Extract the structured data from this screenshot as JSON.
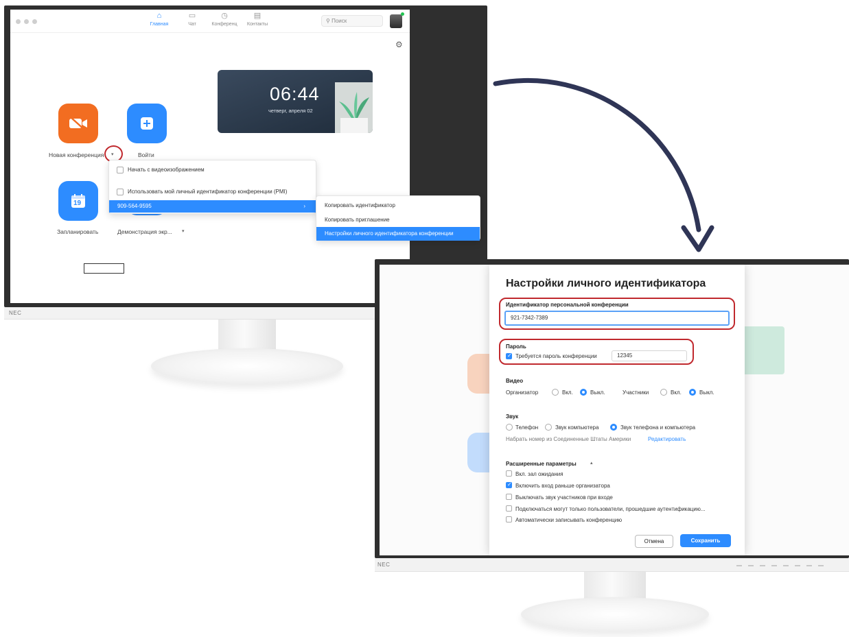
{
  "zoom_home": {
    "tabs": [
      {
        "label": "Главная",
        "icon": "home-icon"
      },
      {
        "label": "Чат",
        "icon": "chat-icon"
      },
      {
        "label": "Конференц",
        "icon": "clock-icon"
      },
      {
        "label": "Контакты",
        "icon": "contacts-icon"
      }
    ],
    "search_placeholder": "Поиск",
    "actions": {
      "new_meeting": "Новая конференция",
      "join": "Войти",
      "schedule": "Запланировать",
      "screen_share": "Демонстрация экр...",
      "calendar_day": "19"
    },
    "clock": {
      "time": "06:44",
      "date": "четверг, апреля 02"
    },
    "dropdown": {
      "start_with_video": "Начать с видеоизображением",
      "use_pmi": "Использовать мой личный идентификатор конференции (PMI)",
      "pmi_number": "909-564-9595"
    },
    "submenu": {
      "copy_id": "Копировать идентификатор",
      "copy_invite": "Копировать приглашение",
      "pmi_settings": "Настройки личного идентификатора конференции"
    }
  },
  "monitor": {
    "brand": "NEC"
  },
  "settings_dialog": {
    "title": "Настройки личного идентификатора",
    "pmi": {
      "label": "Идентификатор персональной конференции",
      "value": "921-7342-7389"
    },
    "password": {
      "heading": "Пароль",
      "require_label": "Требуется пароль конференции",
      "value": "12345",
      "checked": true
    },
    "video": {
      "heading": "Видео",
      "host_label": "Организатор",
      "participants_label": "Участники",
      "on": "Вкл.",
      "off": "Выкл."
    },
    "audio": {
      "heading": "Звук",
      "telephone": "Телефон",
      "computer_audio": "Звук компьютера",
      "both": "Звук телефона и компьютера",
      "dial_from": "Набрать номер из Соединенные Штаты Америки",
      "edit": "Редактировать"
    },
    "advanced": {
      "heading": "Расширенные параметры",
      "options": [
        {
          "label": "Вкл. зал ожидания",
          "checked": false
        },
        {
          "label": "Включить вход раньше организатора",
          "checked": true
        },
        {
          "label": "Выключать звук участников при входе",
          "checked": false
        },
        {
          "label": "Подключаться могут только пользователи, прошедшие аутентификацию...",
          "checked": false
        },
        {
          "label": "Автоматически записывать конференцию",
          "checked": false
        }
      ]
    },
    "buttons": {
      "cancel": "Отмена",
      "save": "Сохранить"
    }
  },
  "colors": {
    "accent": "#2d8cff",
    "orange": "#f26d21",
    "highlight_red": "#c0282d",
    "arrow": "#2f3556"
  }
}
